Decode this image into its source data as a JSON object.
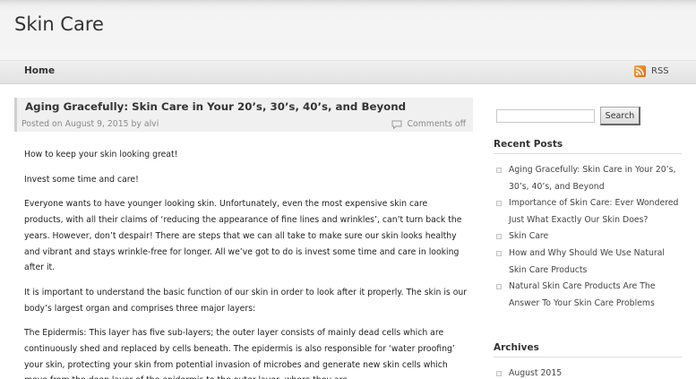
{
  "site": {
    "title": "Skin Care"
  },
  "nav": {
    "home": "Home",
    "rss": "RSS"
  },
  "post": {
    "title": "Aging Gracefully: Skin Care in Your 20’s, 30’s, 40’s, and Beyond",
    "posted_on_label": "Posted on",
    "date": "August 9, 2015",
    "by_label": "by",
    "author": "alvi",
    "comments": "Comments off",
    "paragraphs": [
      "How to keep your skin looking great!",
      "Invest some time and care!",
      "Everyone wants to have younger looking skin. Unfortunately, even the most expensive skin care products, with all their claims of ‘reducing the appearance of fine lines and wrinkles’, can’t turn back the years. However, don’t despair! There are steps that we can all take to make sure our skin looks healthy and vibrant and stays wrinkle-free for longer. All we’ve got to do is invest some time and care in looking after it.",
      "It is important to understand the basic function of our skin in order to look after it properly. The skin is our body’s largest organ and comprises three major layers:",
      "The Epidermis: This layer has five sub-layers; the outer layer consists of mainly dead cells which are continuously shed and replaced by cells beneath. The epidermis is also responsible for ‘water proofing’ your skin, protecting your skin from potential invasion of microbes and generate new skin cells which move from the deep layer of the epidermis to the outer layer, where they are"
    ]
  },
  "sidebar": {
    "search_button": "Search",
    "search_value": "",
    "recent_title": "Recent Posts",
    "recent_posts": [
      "Aging Gracefully: Skin Care in Your 20’s, 30’s, 40’s, and Beyond",
      "Importance of Skin Care: Ever Wondered Just What Exactly Our Skin Does?",
      "Skin Care",
      "How and Why Should We Use Natural Skin Care Products",
      "Natural Skin Care Products Are The Answer To Your Skin Care Problems"
    ],
    "archives_title": "Archives",
    "archives": [
      "August 2015"
    ]
  },
  "icons": {
    "rss": "rss-icon",
    "comments": "comment-bubble-icon",
    "bullet": "square-bullet-icon"
  }
}
